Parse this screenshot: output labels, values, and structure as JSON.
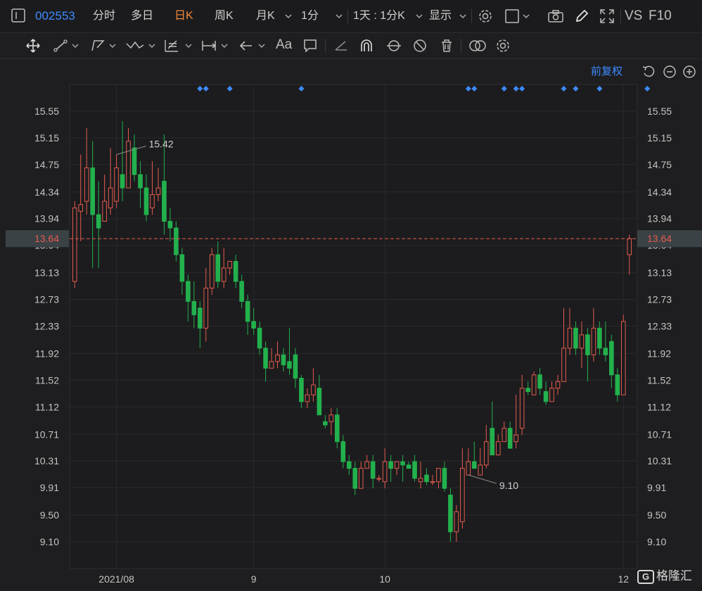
{
  "topbar": {
    "code": "002553",
    "periods": [
      "分时",
      "多日",
      "日K",
      "周K"
    ],
    "active_period": "日K",
    "month_label": "月K",
    "minute_label": "1分",
    "multi_label": "1天 : 1分K",
    "display_label": "显示",
    "vs_label": "VS",
    "f10_label": "F10"
  },
  "toolbar": {
    "text_tool": "Aa"
  },
  "fuquan_label": "前复权",
  "logo_text": "格隆汇",
  "colors": {
    "up": "#e55b4e",
    "down": "#23b14d",
    "accent": "#3d8bff",
    "active": "#f08a3c",
    "current_price": "#e55b4e"
  },
  "chart_data": {
    "type": "candlestick",
    "y_ticks": [
      "15.55",
      "15.15",
      "14.75",
      "14.34",
      "13.94",
      "13.64",
      "13.13",
      "12.73",
      "12.33",
      "11.92",
      "11.52",
      "11.12",
      "10.71",
      "10.31",
      "9.91",
      "9.50",
      "9.10"
    ],
    "y_tick_values": [
      15.55,
      15.15,
      14.75,
      14.34,
      13.94,
      13.54,
      13.13,
      12.73,
      12.33,
      11.92,
      11.52,
      11.12,
      10.71,
      10.31,
      9.91,
      9.5,
      9.1
    ],
    "ylim": [
      8.7,
      15.95
    ],
    "x_labels": [
      {
        "label": "2021/08",
        "index": 7
      },
      {
        "label": "9",
        "index": 30
      },
      {
        "label": "10",
        "index": 52
      },
      {
        "label": "12",
        "index": 92
      }
    ],
    "current_price": 13.64,
    "max_label": "15.42",
    "min_label": "9.10",
    "max_index": 7,
    "min_index": 66,
    "event_indices": [
      21,
      22,
      26,
      38,
      66,
      67,
      72,
      74,
      75,
      82,
      84,
      88,
      96
    ],
    "candles": [
      [
        13.0,
        14.1,
        14.2,
        12.9
      ],
      [
        14.05,
        14.15,
        14.9,
        13.6
      ],
      [
        14.2,
        14.7,
        15.3,
        14.0
      ],
      [
        14.7,
        14.0,
        15.1,
        13.2
      ],
      [
        14.0,
        13.8,
        14.5,
        13.2
      ],
      [
        13.9,
        14.2,
        14.6,
        13.9
      ],
      [
        14.1,
        14.4,
        15.0,
        14.0
      ],
      [
        14.2,
        14.7,
        14.9,
        14.1
      ],
      [
        14.6,
        14.4,
        15.4,
        14.2
      ],
      [
        14.4,
        15.1,
        15.3,
        14.4
      ],
      [
        15.0,
        14.6,
        15.2,
        14.5
      ],
      [
        14.6,
        14.4,
        14.8,
        14.1
      ],
      [
        14.4,
        14.0,
        14.6,
        13.9
      ],
      [
        14.1,
        14.3,
        14.8,
        14.0
      ],
      [
        14.3,
        14.4,
        14.7,
        14.2
      ],
      [
        14.5,
        13.9,
        15.2,
        13.7
      ],
      [
        13.9,
        13.8,
        14.1,
        13.6
      ],
      [
        13.8,
        13.4,
        13.9,
        13.3
      ],
      [
        13.4,
        13.0,
        13.5,
        12.8
      ],
      [
        13.0,
        12.7,
        13.1,
        12.4
      ],
      [
        12.7,
        12.5,
        13.0,
        12.3
      ],
      [
        12.6,
        12.3,
        12.7,
        12.0
      ],
      [
        12.3,
        12.9,
        13.2,
        12.1
      ],
      [
        12.9,
        13.4,
        13.5,
        12.8
      ],
      [
        13.4,
        13.0,
        13.6,
        12.9
      ],
      [
        13.0,
        13.2,
        13.5,
        12.9
      ],
      [
        13.2,
        13.3,
        13.3,
        13.1
      ],
      [
        13.3,
        13.0,
        13.4,
        12.9
      ],
      [
        13.0,
        12.7,
        13.1,
        12.6
      ],
      [
        12.7,
        12.4,
        12.8,
        12.2
      ],
      [
        12.4,
        12.3,
        12.6,
        12.2
      ],
      [
        12.3,
        12.0,
        12.4,
        11.9
      ],
      [
        12.0,
        11.7,
        12.1,
        11.5
      ],
      [
        11.7,
        11.8,
        12.0,
        11.7
      ],
      [
        11.8,
        11.9,
        12.1,
        11.7
      ],
      [
        11.9,
        11.75,
        12.0,
        11.65
      ],
      [
        11.8,
        11.7,
        12.3,
        11.6
      ],
      [
        11.9,
        11.55,
        12.0,
        11.4
      ],
      [
        11.55,
        11.2,
        11.6,
        11.1
      ],
      [
        11.2,
        11.3,
        11.4,
        11.1
      ],
      [
        11.3,
        11.45,
        11.7,
        11.2
      ],
      [
        11.4,
        11.0,
        11.6,
        11.0
      ],
      [
        10.9,
        10.85,
        11.0,
        10.8
      ],
      [
        10.9,
        11.0,
        11.1,
        10.7
      ],
      [
        11.0,
        10.6,
        11.1,
        10.5
      ],
      [
        10.6,
        10.3,
        10.7,
        10.2
      ],
      [
        10.3,
        10.2,
        10.4,
        10.1
      ],
      [
        10.2,
        9.9,
        10.3,
        9.8
      ],
      [
        9.9,
        10.2,
        10.3,
        9.9
      ],
      [
        10.2,
        10.3,
        10.4,
        10.2
      ],
      [
        10.3,
        10.05,
        10.4,
        9.9
      ],
      [
        10.05,
        10.05,
        10.1,
        10.0
      ],
      [
        10.0,
        10.3,
        10.5,
        9.9
      ],
      [
        10.3,
        10.2,
        10.4,
        10.0
      ],
      [
        10.2,
        10.3,
        10.3,
        10.1
      ],
      [
        10.3,
        10.25,
        10.4,
        10.0
      ],
      [
        10.25,
        10.2,
        10.3,
        10.2
      ],
      [
        10.3,
        10.05,
        10.4,
        10.0
      ],
      [
        10.0,
        10.05,
        10.3,
        9.9
      ],
      [
        10.1,
        10.0,
        10.2,
        9.95
      ],
      [
        10.0,
        10.0,
        10.1,
        9.95
      ],
      [
        10.0,
        10.2,
        10.2,
        9.9
      ],
      [
        10.2,
        9.9,
        10.3,
        9.85
      ],
      [
        9.8,
        9.25,
        9.9,
        9.1
      ],
      [
        9.25,
        9.55,
        9.65,
        9.1
      ],
      [
        9.4,
        10.2,
        10.5,
        9.3
      ],
      [
        10.1,
        10.3,
        10.5,
        10.1
      ],
      [
        10.3,
        10.2,
        10.6,
        10.2
      ],
      [
        10.1,
        10.25,
        10.5,
        10.1
      ],
      [
        10.25,
        10.6,
        10.85,
        10.2
      ],
      [
        10.8,
        10.4,
        11.2,
        10.4
      ],
      [
        10.4,
        10.6,
        10.7,
        10.4
      ],
      [
        10.6,
        10.8,
        10.9,
        10.6
      ],
      [
        10.8,
        10.5,
        10.9,
        10.5
      ],
      [
        10.6,
        10.7,
        11.3,
        10.5
      ],
      [
        10.8,
        11.4,
        11.6,
        10.7
      ],
      [
        11.4,
        11.35,
        11.5,
        11.3
      ],
      [
        11.3,
        11.6,
        11.65,
        11.3
      ],
      [
        11.6,
        11.4,
        11.7,
        11.3
      ],
      [
        11.35,
        11.2,
        11.5,
        11.15
      ],
      [
        11.2,
        11.4,
        11.5,
        11.2
      ],
      [
        11.4,
        11.5,
        11.6,
        11.3
      ],
      [
        11.5,
        12.0,
        12.6,
        11.6
      ],
      [
        12.0,
        12.3,
        12.6,
        11.9
      ],
      [
        12.3,
        12.0,
        12.4,
        11.9
      ],
      [
        12.0,
        12.2,
        12.4,
        11.7
      ],
      [
        12.2,
        11.9,
        12.3,
        11.5
      ],
      [
        11.9,
        12.3,
        12.6,
        11.8
      ],
      [
        12.3,
        12.0,
        12.4,
        11.9
      ],
      [
        12.0,
        11.9,
        12.4,
        11.8
      ],
      [
        12.1,
        11.6,
        12.2,
        11.4
      ],
      [
        11.6,
        11.3,
        11.7,
        11.2
      ],
      [
        11.3,
        12.4,
        12.5,
        11.3
      ],
      [
        13.4,
        13.64,
        13.7,
        13.1
      ]
    ]
  }
}
